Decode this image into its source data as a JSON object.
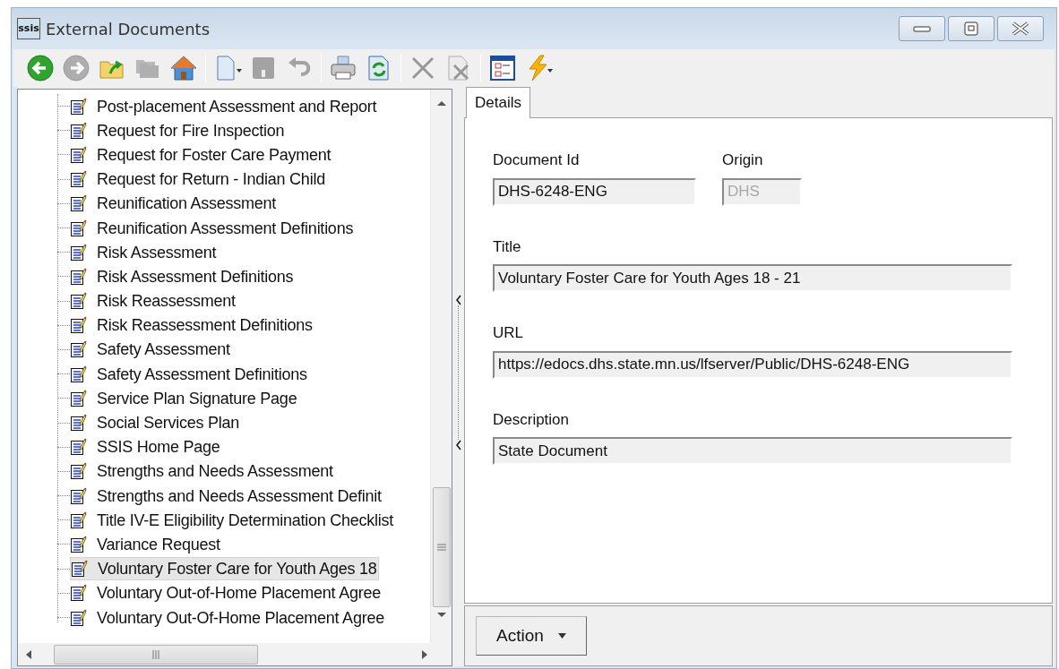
{
  "window": {
    "title": "External Documents",
    "logo_text": "ssis"
  },
  "toolbar": [
    {
      "kind": "back",
      "disabled": false
    },
    {
      "kind": "forward",
      "disabled": true
    },
    {
      "kind": "folder_up",
      "disabled": false
    },
    {
      "kind": "folders",
      "disabled": true
    },
    {
      "kind": "home",
      "disabled": false
    },
    {
      "kind": "separator"
    },
    {
      "kind": "new",
      "disabled": false
    },
    {
      "kind": "save",
      "disabled": true
    },
    {
      "kind": "undo",
      "disabled": true
    },
    {
      "kind": "separator"
    },
    {
      "kind": "print",
      "disabled": false
    },
    {
      "kind": "refresh",
      "disabled": false
    },
    {
      "kind": "separator"
    },
    {
      "kind": "delete",
      "disabled": true
    },
    {
      "kind": "delete_doc",
      "disabled": true
    },
    {
      "kind": "separator"
    },
    {
      "kind": "checklist",
      "disabled": false
    },
    {
      "kind": "lightning",
      "disabled": false
    }
  ],
  "tree": {
    "items": [
      {
        "label": "Post-placement Assessment and Report",
        "selected": false
      },
      {
        "label": "Request for Fire Inspection",
        "selected": false
      },
      {
        "label": "Request for Foster Care Payment",
        "selected": false
      },
      {
        "label": "Request for Return - Indian Child",
        "selected": false
      },
      {
        "label": "Reunification Assessment",
        "selected": false
      },
      {
        "label": "Reunification Assessment Definitions",
        "selected": false
      },
      {
        "label": "Risk Assessment",
        "selected": false
      },
      {
        "label": "Risk Assessment Definitions",
        "selected": false
      },
      {
        "label": "Risk Reassessment",
        "selected": false
      },
      {
        "label": "Risk Reassessment Definitions",
        "selected": false
      },
      {
        "label": "Safety Assessment",
        "selected": false
      },
      {
        "label": "Safety Assessment Definitions",
        "selected": false
      },
      {
        "label": "Service Plan Signature Page",
        "selected": false
      },
      {
        "label": "Social Services Plan",
        "selected": false
      },
      {
        "label": "SSIS Home Page",
        "selected": false
      },
      {
        "label": "Strengths and Needs Assessment",
        "selected": false
      },
      {
        "label": "Strengths and Needs Assessment Definit",
        "selected": false
      },
      {
        "label": "Title IV-E Eligibility Determination Checklist",
        "selected": false
      },
      {
        "label": "Variance Request",
        "selected": false
      },
      {
        "label": "Voluntary Foster Care for Youth Ages 18",
        "selected": true
      },
      {
        "label": "Voluntary Out-of-Home Placement Agree",
        "selected": false
      },
      {
        "label": "Voluntary Out-Of-Home Placement Agree",
        "selected": false
      }
    ]
  },
  "tabs": [
    {
      "label": "Details",
      "selected": true
    }
  ],
  "fields": [
    {
      "kind": "short",
      "label": "Document Id",
      "value": "DHS-6248-ENG",
      "disabled": false
    },
    {
      "kind": "tiny",
      "label": "Origin",
      "value": "DHS",
      "disabled": true
    },
    {
      "kind": "wide",
      "label": "Title",
      "value": "Voluntary Foster Care for Youth Ages 18 - 21",
      "disabled": false
    },
    {
      "kind": "wide",
      "label": "URL",
      "value": "https://edocs.dhs.state.mn.us/lfserver/Public/DHS-6248-ENG",
      "disabled": false
    },
    {
      "kind": "wide",
      "label": "Description",
      "value": "State Document",
      "disabled": false
    }
  ],
  "action_button": {
    "label": "Action"
  }
}
